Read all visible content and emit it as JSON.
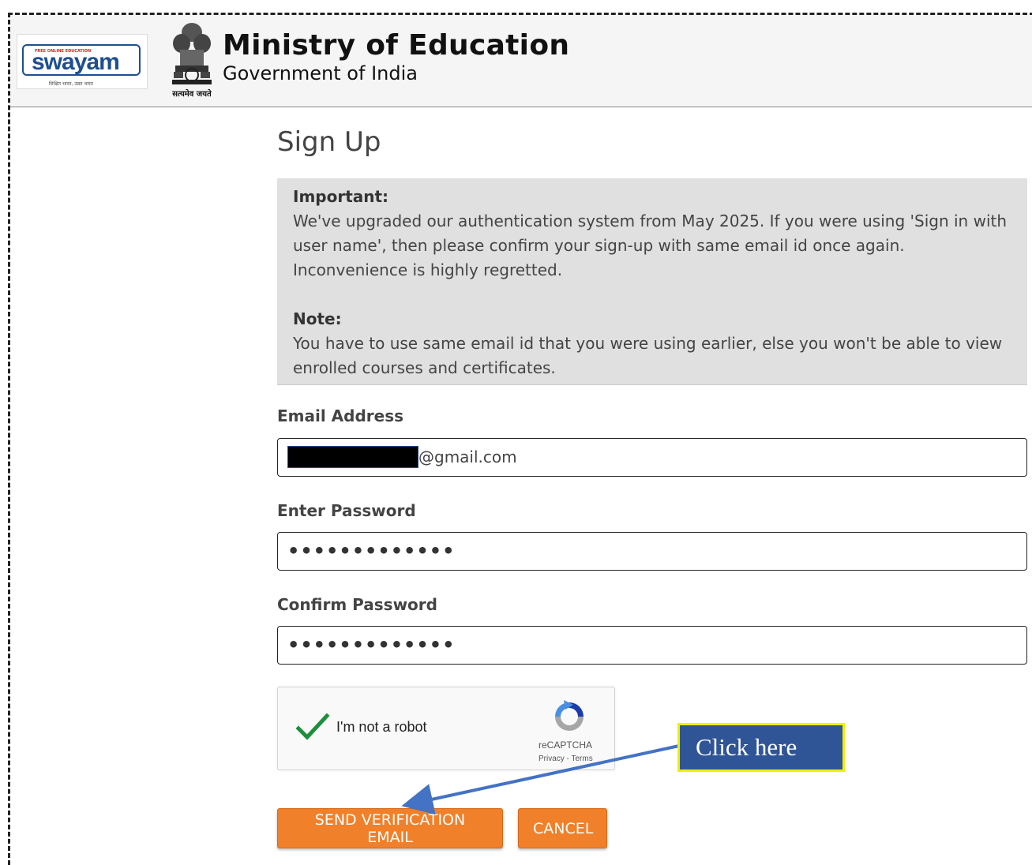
{
  "header": {
    "logo_small": "FREE ONLINE EDUCATION",
    "logo_word": "swayam",
    "logo_tagline": "शिक्षित भारत, उन्नत भारत",
    "emblem_caption": "सत्यमेव जयते",
    "ministry_title": "Ministry of Education",
    "ministry_subtitle": "Government of India"
  },
  "page": {
    "title": "Sign Up"
  },
  "notice": {
    "important_label": "Important:",
    "important_text": "We've upgraded our authentication system from May 2025. If you were using 'Sign in with user name', then please confirm your sign-up with same email id once again. Inconvenience is highly regretted.",
    "note_label": "Note:",
    "note_text": "You have to use same email id that you were using earlier, else you won't be able to view enrolled courses and certificates."
  },
  "form": {
    "email_label": "Email Address",
    "email_value_suffix": "@gmail.com",
    "password_label": "Enter Password",
    "password_value": "•••••••••••••",
    "confirm_label": "Confirm Password",
    "confirm_value": "•••••••••••••"
  },
  "captcha": {
    "label": "I'm not a robot",
    "brand": "reCAPTCHA",
    "links": "Privacy - Terms",
    "checked": true
  },
  "buttons": {
    "send": "SEND VERIFICATION EMAIL",
    "cancel": "CANCEL"
  },
  "annotation": {
    "callout": "Click here",
    "callout_bg": "#2f5597",
    "callout_border": "#f0f000",
    "arrow_color": "#4472c4"
  },
  "colors": {
    "button": "#f0802a",
    "notice_bg": "#e0e0e0",
    "check": "#1e8e3e"
  }
}
